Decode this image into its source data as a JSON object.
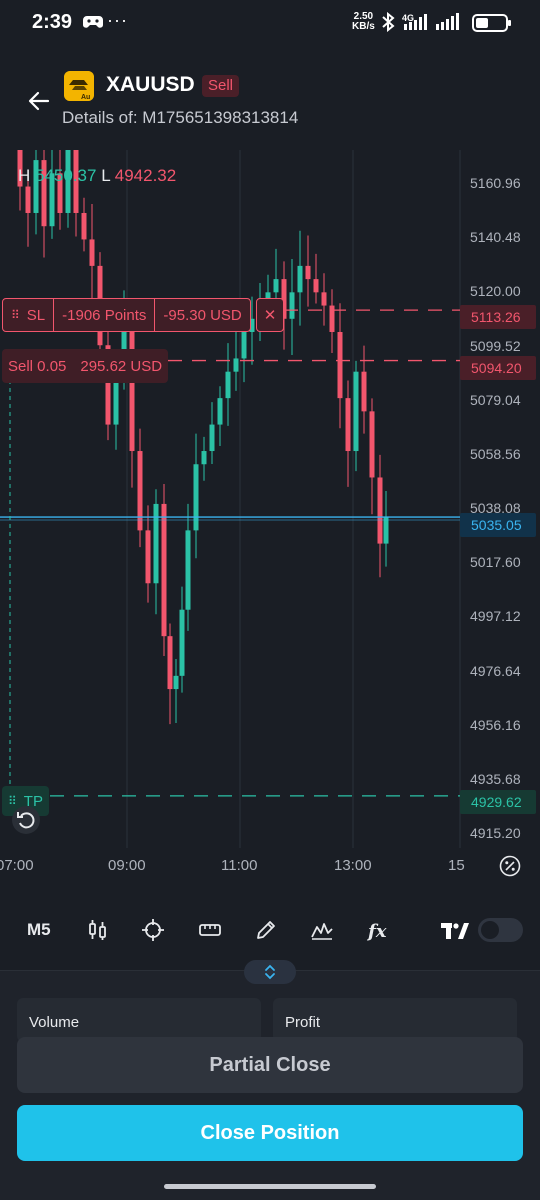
{
  "status_bar": {
    "time": "2:39",
    "dots": "···",
    "speed_value": "2.50",
    "speed_unit": "KB/s",
    "network": "4G"
  },
  "header": {
    "symbol": "XAUUSD",
    "side": "Sell",
    "details": "Details of: M175651398313814",
    "logo_text": "Au"
  },
  "chart": {
    "high_label": "H",
    "high_value": "5450.37",
    "low_label": "L",
    "low_value": "4942.32",
    "price_ticks": [
      "5160.96",
      "5140.48",
      "5120.00",
      "5099.52",
      "5079.04",
      "5058.56",
      "5038.08",
      "5017.60",
      "4997.12",
      "4976.64",
      "4956.16",
      "4935.68",
      "4915.20"
    ],
    "time_ticks": [
      "07:00",
      "09:00",
      "11:00",
      "13:00",
      "15"
    ],
    "sl_price": "5113.26",
    "entry_price": "5094.20",
    "current_price": "5035.05",
    "tp_price": "4929.62"
  },
  "chart_data": {
    "type": "candlestick",
    "title": "",
    "ylim": [
      4915.2,
      5160.96
    ],
    "x_ticks": [
      "07:00",
      "09:00",
      "11:00",
      "13:00",
      "15"
    ],
    "y_ticks": [
      5160.96,
      5140.48,
      5120.0,
      5099.52,
      5079.04,
      5058.56,
      5038.08,
      5017.6,
      4997.12,
      4976.64,
      4956.16,
      4935.68,
      4915.2
    ],
    "current": 5035.05,
    "colors": {
      "up": "#2bc2a6",
      "down": "#f2566d",
      "current": "#3ab4f0"
    }
  },
  "orders": {
    "sl_label": "SL",
    "sl_points": "-1906 Points",
    "sl_usd": "-95.30 USD",
    "sl_close": "✕",
    "sell_label": "Sell 0.05",
    "sell_value": "295.62 USD",
    "tp_label": "TP"
  },
  "toolbar": {
    "timeframe": "M5"
  },
  "panel": {
    "volume_label": "Volume",
    "profit_label": "Profit",
    "partial_close": "Partial Close",
    "close_position": "Close Position"
  }
}
